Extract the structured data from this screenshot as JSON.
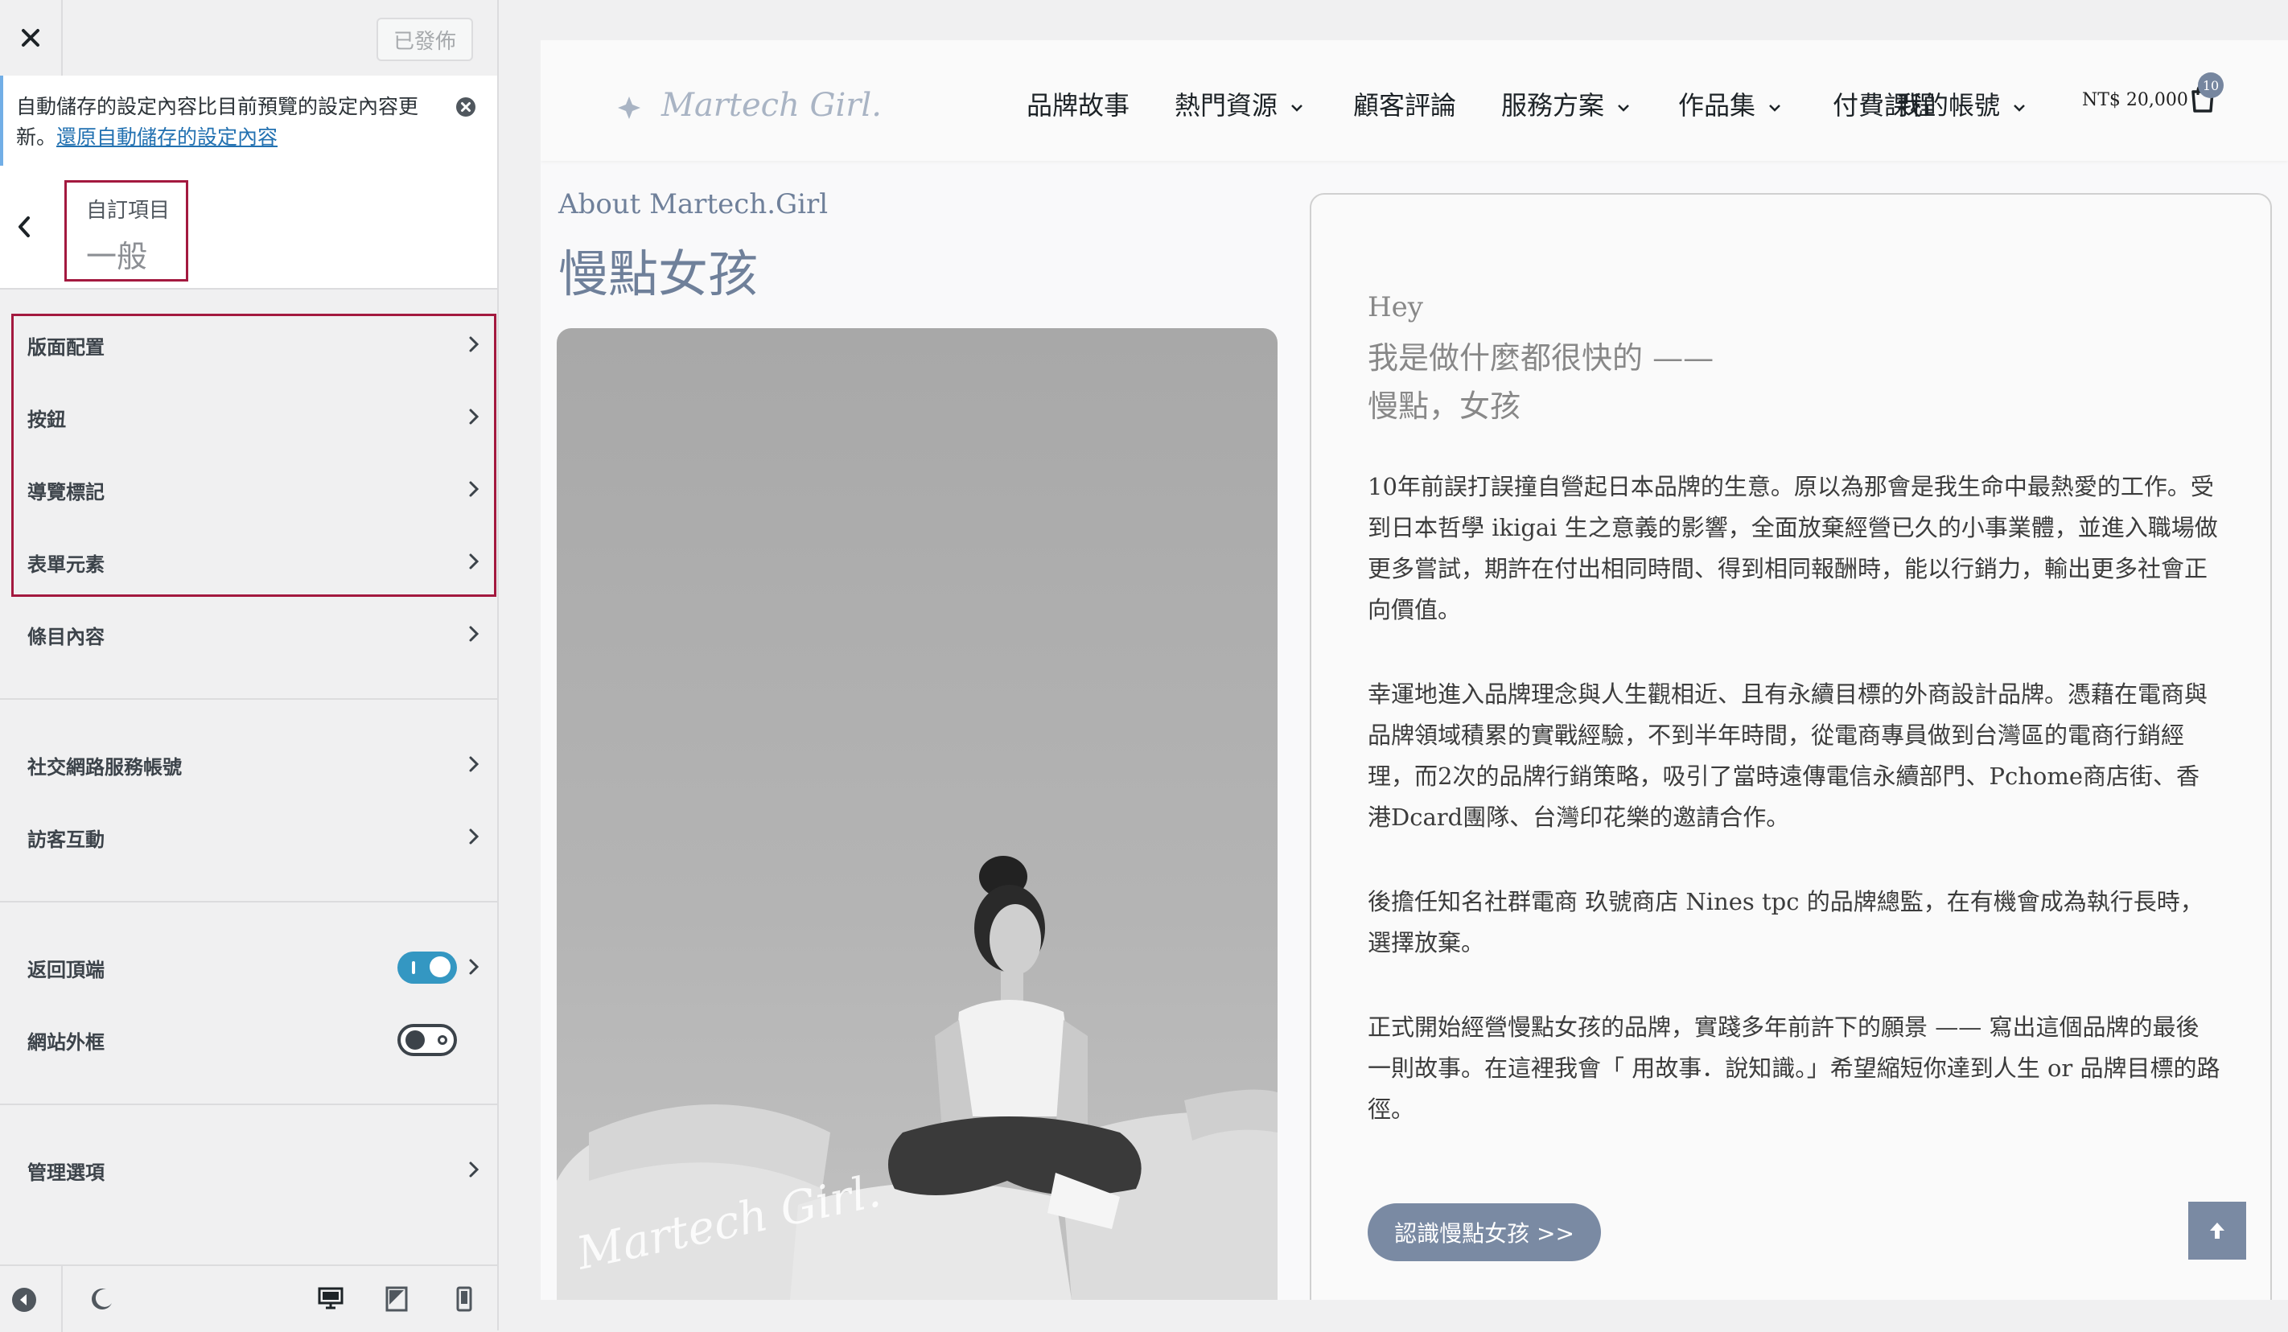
{
  "customizer": {
    "publish_label": "已發佈",
    "notice_text": "自動儲存的設定內容比目前預覽的設定內容更新。",
    "notice_link": "還原自動儲存的設定內容",
    "section_sub": "自訂項目",
    "section_title": "一般",
    "menu": [
      {
        "label": "版面配置"
      },
      {
        "label": "按鈕"
      },
      {
        "label": "導覽標記"
      },
      {
        "label": "表單元素"
      },
      {
        "label": "條目內容"
      },
      {
        "label": "社交網路服務帳號"
      },
      {
        "label": "訪客互動"
      },
      {
        "label": "返回頂端",
        "toggle": "on"
      },
      {
        "label": "網站外框",
        "toggle": "off"
      },
      {
        "label": "管理選項"
      }
    ]
  },
  "site": {
    "logo_text": "Martech Girl.",
    "nav": [
      "品牌故事",
      "熱門資源",
      "顧客評論",
      "服務方案",
      "作品集",
      "付費課程",
      "我的帳號"
    ],
    "cart_total": "NT$ 20,000",
    "cart_count": "10",
    "about_label": "About Martech.Girl",
    "about_title": "慢點女孩",
    "photo_watermark": "Martech Girl.",
    "card": {
      "hey": "Hey",
      "lead1": "我是做什麼都很快的 ——",
      "lead2": "慢點，女孩",
      "p1": "10年前誤打誤撞自營起日本品牌的生意。原以為那會是我生命中最熱愛的工作。受到日本哲學 ikigai 生之意義的影響，全面放棄經營已久的小事業體，並進入職場做更多嘗試，期許在付出相同時間、得到相同報酬時，能以行銷力，輸出更多社會正向價值。",
      "p2": "幸運地進入品牌理念與人生觀相近、且有永續目標的外商設計品牌。憑藉在電商與品牌領域積累的實戰經驗，不到半年時間，從電商專員做到台灣區的電商行銷經理，而2次的品牌行銷策略，吸引了當時遠傳電信永續部門、Pchome商店街、香港Dcard團隊、台灣印花樂的邀請合作。",
      "p3": "後擔任知名社群電商 玖號商店 Nines tpc 的品牌總監，在有機會成為執行長時，選擇放棄。",
      "p4": "正式開始經營慢點女孩的品牌，實踐多年前許下的願景 —— 寫出這個品牌的最後一則故事。在這裡我會「 用故事．說知識。」希望縮短你達到人生 or 品牌目標的路徑。",
      "button": "認識慢點女孩 >>"
    }
  },
  "colors": {
    "accent": "#7a8aa3",
    "highlight": "#a3193f",
    "toggle_on": "#3497c2"
  }
}
